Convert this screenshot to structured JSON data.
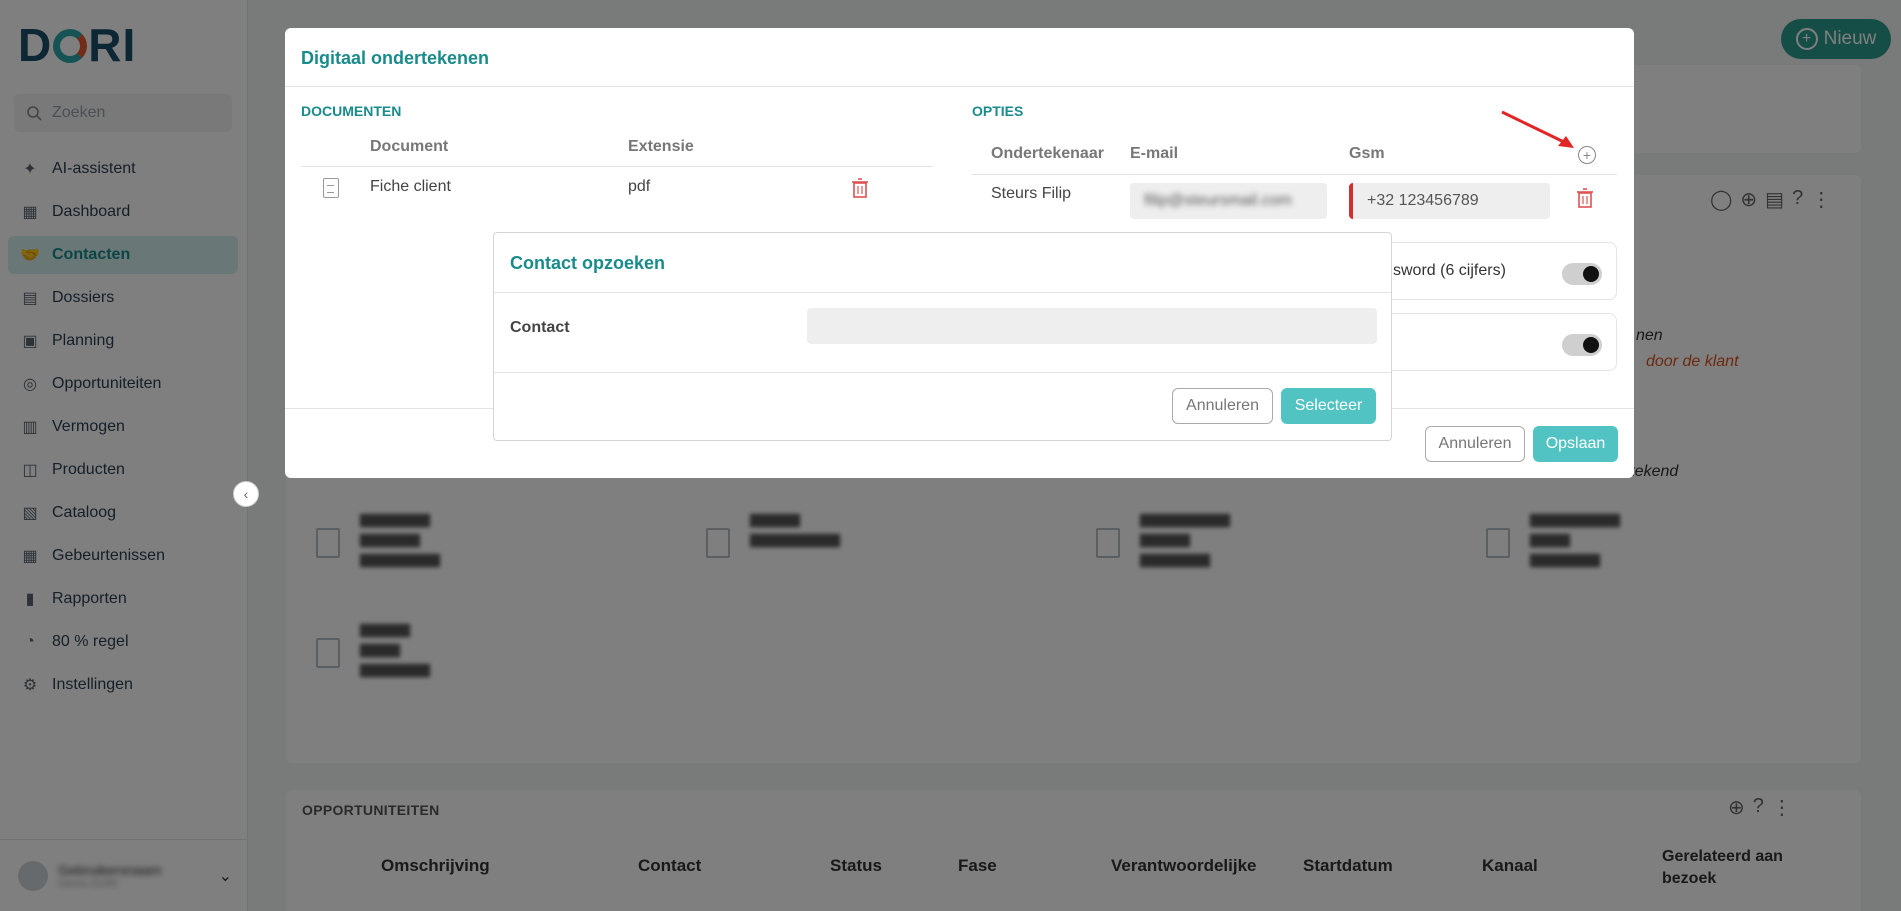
{
  "app": {
    "logo": "DORI",
    "new_button": "Nieuw"
  },
  "sidebar": {
    "search_placeholder": "Zoeken",
    "items": [
      {
        "label": "AI-assistent",
        "icon": "sparkle-icon"
      },
      {
        "label": "Dashboard",
        "icon": "dashboard-icon"
      },
      {
        "label": "Contacten",
        "icon": "handshake-icon",
        "active": true
      },
      {
        "label": "Dossiers",
        "icon": "folder-icon"
      },
      {
        "label": "Planning",
        "icon": "calendar-icon"
      },
      {
        "label": "Opportuniteiten",
        "icon": "lightbulb-icon"
      },
      {
        "label": "Vermogen",
        "icon": "chart-icon"
      },
      {
        "label": "Producten",
        "icon": "briefcase-icon"
      },
      {
        "label": "Cataloog",
        "icon": "catalog-icon"
      },
      {
        "label": "Gebeurtenissen",
        "icon": "grid-icon"
      },
      {
        "label": "Rapporten",
        "icon": "report-icon"
      },
      {
        "label": "80 % regel",
        "icon": "hand-coins-icon"
      },
      {
        "label": "Instellingen",
        "icon": "gear-icon"
      }
    ],
    "user_name": "Gebruikersnaam",
    "user_sub": "Demo DORI"
  },
  "background": {
    "opportunities_title": "OPPORTUNITEITEN",
    "opportunities_headers": [
      "Omschrijving",
      "Contact",
      "Status",
      "Fase",
      "Verantwoordelijke",
      "Startdatum",
      "Kanaal",
      "Gerelateerd aan bezoek"
    ],
    "right_texts": [
      "nen",
      "door de klant",
      "ertekend"
    ]
  },
  "modal": {
    "title": "Digitaal ondertekenen",
    "documents_label": "DOCUMENTEN",
    "options_label": "OPTIES",
    "doc_headers": {
      "document": "Document",
      "extension": "Extensie"
    },
    "documents": [
      {
        "name": "Fiche client",
        "extension": "pdf"
      }
    ],
    "signer_headers": {
      "signer": "Ondertekenaar",
      "email": "E-mail",
      "gsm": "Gsm"
    },
    "signers": [
      {
        "name": "Steurs Filip",
        "email": "filip@steursmail.com",
        "gsm": "+32 123456789"
      }
    ],
    "option_password": "sword (6 cijfers)",
    "cancel": "Annuleren",
    "save": "Opslaan"
  },
  "dialog": {
    "title": "Contact opzoeken",
    "contact_label": "Contact",
    "contact_value": "",
    "cancel": "Annuleren",
    "select": "Selecteer"
  }
}
